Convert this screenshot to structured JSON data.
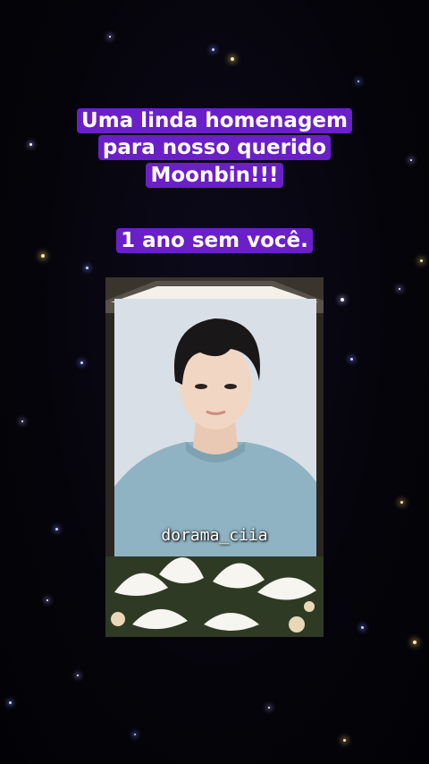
{
  "caption": {
    "line1": "Uma linda homenagem",
    "line2": "para nosso querido",
    "line3": "Moonbin!!!",
    "subtitle": "1 ano sem você.",
    "highlight_color": "#6a1fc9"
  },
  "photo": {
    "watermark": "dorama_ciia"
  },
  "colors": {
    "background": "#05040a",
    "sweater": "#8fb3c2",
    "frame": "#2a2620"
  }
}
